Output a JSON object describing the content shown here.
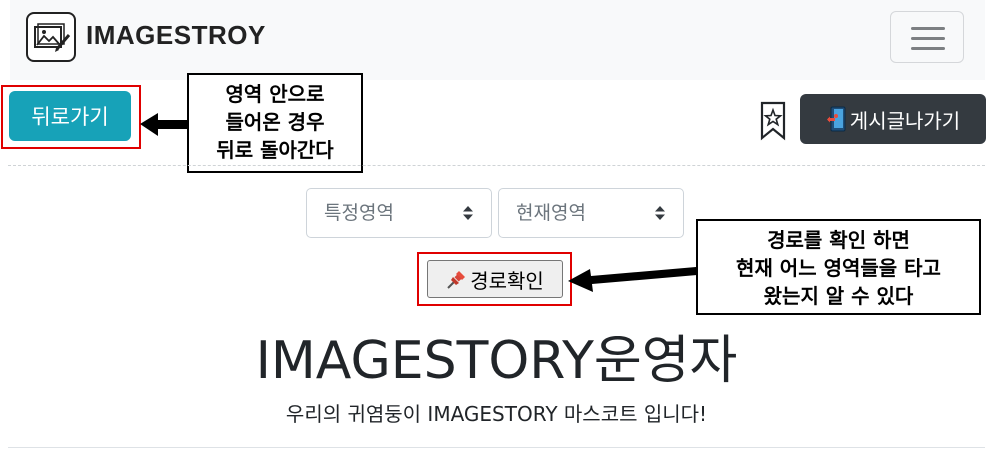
{
  "brand": {
    "name": "IMAGESTROY",
    "logo_icon": "image-pencil-icon"
  },
  "navbar": {
    "toggle_icon": "hamburger-menu-icon"
  },
  "actions": {
    "back_label": "뒤로가기",
    "board_label": "게시글나가기",
    "bookmark_icon": "bookmark-star-icon",
    "board_icon": "door-exit-icon"
  },
  "callouts": {
    "back_note": [
      "영역 안으로",
      "들어온 경우",
      "뒤로 돌아간다"
    ],
    "route_note": [
      "경로를 확인 하면",
      "현재 어느 영역들을 타고",
      "왔는지 알 수 있다"
    ]
  },
  "selects": {
    "specific_area": {
      "selected": "특정영역"
    },
    "current_area": {
      "selected": "현재영역"
    }
  },
  "route_button": {
    "label": "경로확인",
    "icon": "pushpin-icon"
  },
  "profile": {
    "title": "IMAGESTORY운영자",
    "description": "우리의 귀염둥이 IMAGESTORY 마스코트 입니다!"
  },
  "colors": {
    "back_button": "#17a2b8",
    "board_button": "#343a40",
    "annotation_red": "#e00000",
    "navbar_bg": "#f8f9fa"
  }
}
